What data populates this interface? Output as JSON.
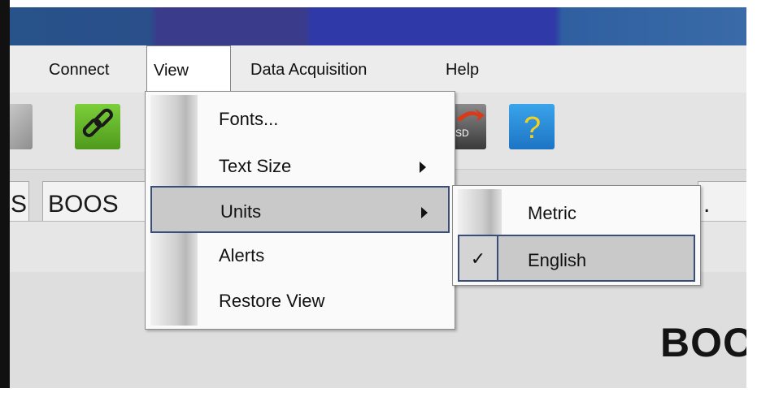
{
  "menubar": {
    "items": [
      {
        "label": "Connect"
      },
      {
        "label": "View"
      },
      {
        "label": "Data Acquisition"
      },
      {
        "label": "Help"
      }
    ]
  },
  "toolbar": {
    "buttons": [
      {
        "icon": "disconnect-icon"
      },
      {
        "icon": "connect-link-icon"
      },
      {
        "icon": "download-icon"
      },
      {
        "icon": "help-icon"
      }
    ]
  },
  "tabs": {
    "items": [
      {
        "label": "S"
      },
      {
        "label": "BOOS"
      },
      {
        "label": ". AC"
      }
    ]
  },
  "view_menu": {
    "items": [
      {
        "label": "Fonts...",
        "submenu": false
      },
      {
        "label": "Text Size",
        "submenu": true
      },
      {
        "label": "Units",
        "submenu": true,
        "highlighted": true
      },
      {
        "label": "Alerts",
        "submenu": false
      },
      {
        "label": "Restore View",
        "submenu": false
      }
    ]
  },
  "units_submenu": {
    "items": [
      {
        "label": "Metric",
        "checked": false
      },
      {
        "label": "English",
        "checked": true,
        "check_mark": "✓"
      }
    ]
  },
  "content": {
    "title": "BOO"
  },
  "colors": {
    "menu_highlight": "#c9c9c9",
    "highlight_border": "#3a4c7a",
    "help_icon_bg": "#2a8fd8",
    "connect_icon_bg": "#6cbc2c"
  }
}
